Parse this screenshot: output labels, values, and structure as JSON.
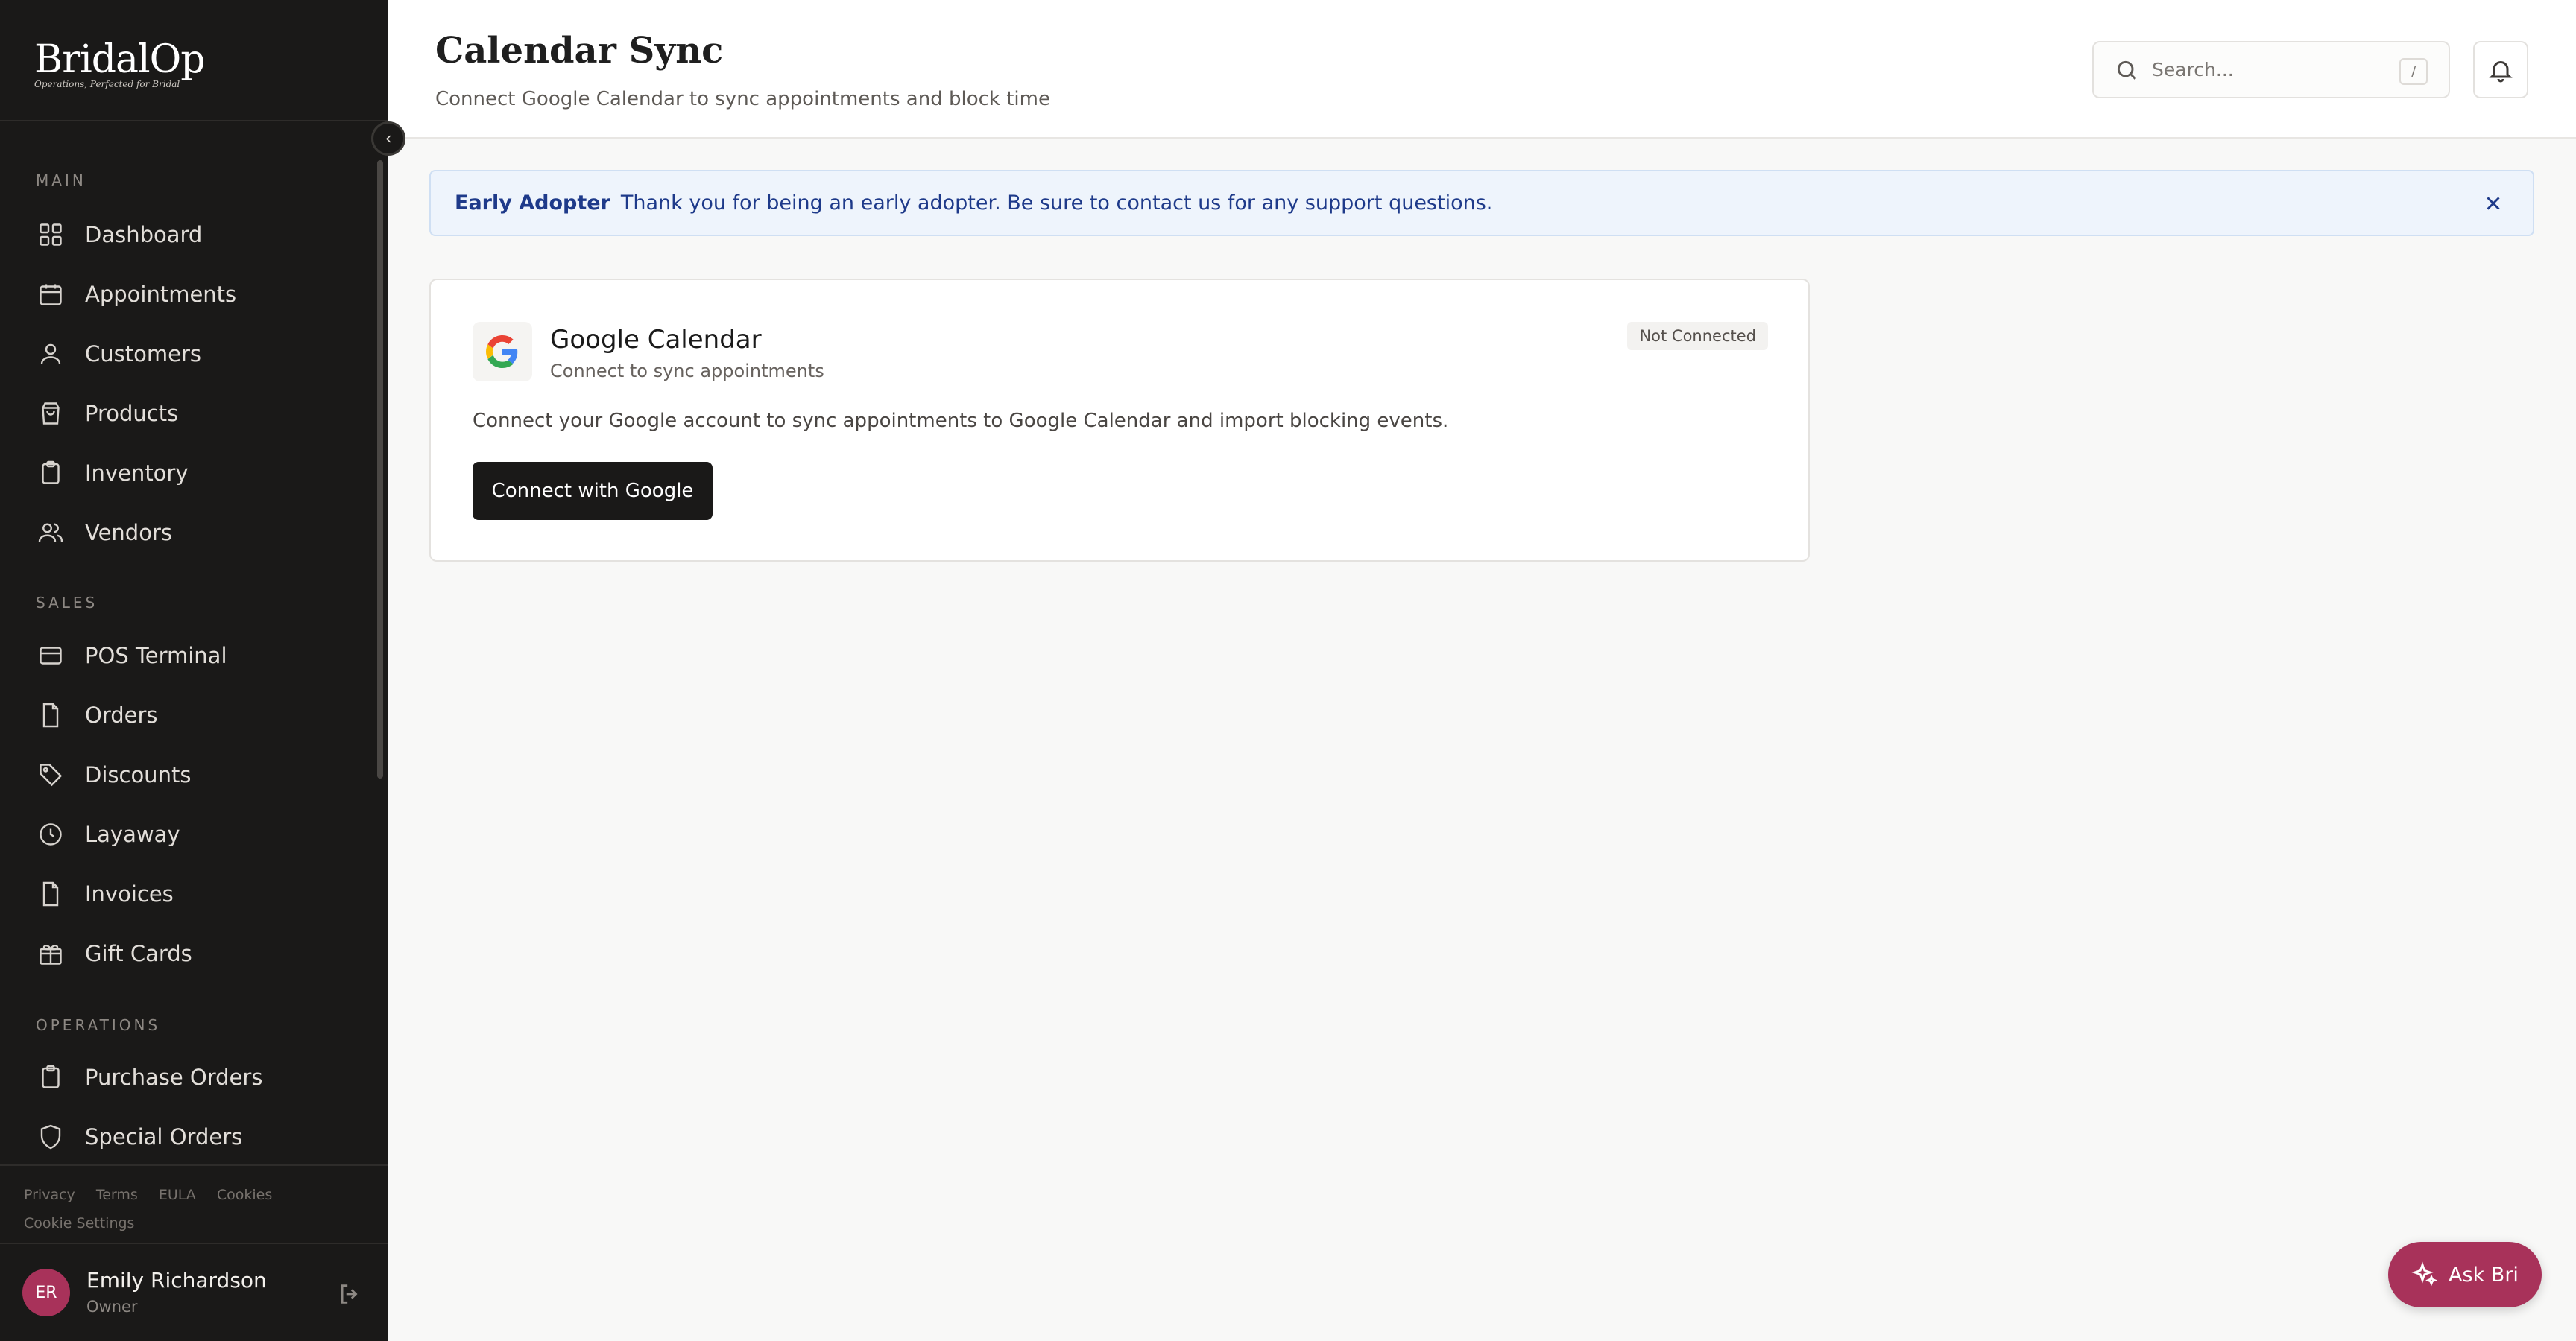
{
  "brand": {
    "name": "BridalOp",
    "tagline": "Operations, Perfected for Bridal"
  },
  "sidebar": {
    "sections": {
      "main": "MAIN",
      "sales": "SALES",
      "operations": "OPERATIONS"
    },
    "items": {
      "dashboard": "Dashboard",
      "appointments": "Appointments",
      "customers": "Customers",
      "products": "Products",
      "inventory": "Inventory",
      "vendors": "Vendors",
      "pos_terminal": "POS Terminal",
      "orders": "Orders",
      "discounts": "Discounts",
      "layaway": "Layaway",
      "invoices": "Invoices",
      "gift_cards": "Gift Cards",
      "purchase_orders": "Purchase Orders",
      "special_orders": "Special Orders"
    },
    "legal": {
      "privacy": "Privacy",
      "terms": "Terms",
      "eula": "EULA",
      "cookies": "Cookies",
      "cookie_settings": "Cookie Settings"
    },
    "user": {
      "initials": "ER",
      "name": "Emily Richardson",
      "role": "Owner"
    }
  },
  "header": {
    "title": "Calendar Sync",
    "subtitle": "Connect Google Calendar to sync appointments and block time",
    "search_placeholder": "Search...",
    "search_shortcut": "/"
  },
  "banner": {
    "tag": "Early Adopter",
    "message": "Thank you for being an early adopter. Be sure to contact us for any support questions."
  },
  "integration": {
    "name": "Google Calendar",
    "subtitle": "Connect to sync appointments",
    "status": "Not Connected",
    "description": "Connect your Google account to sync appointments to Google Calendar and import blocking events.",
    "button_label": "Connect with Google"
  },
  "assistant": {
    "label": "Ask Bri"
  },
  "colors": {
    "accent": "#a8325a",
    "sidebar_bg": "#1a1918",
    "banner_text": "#1e3a8a"
  }
}
